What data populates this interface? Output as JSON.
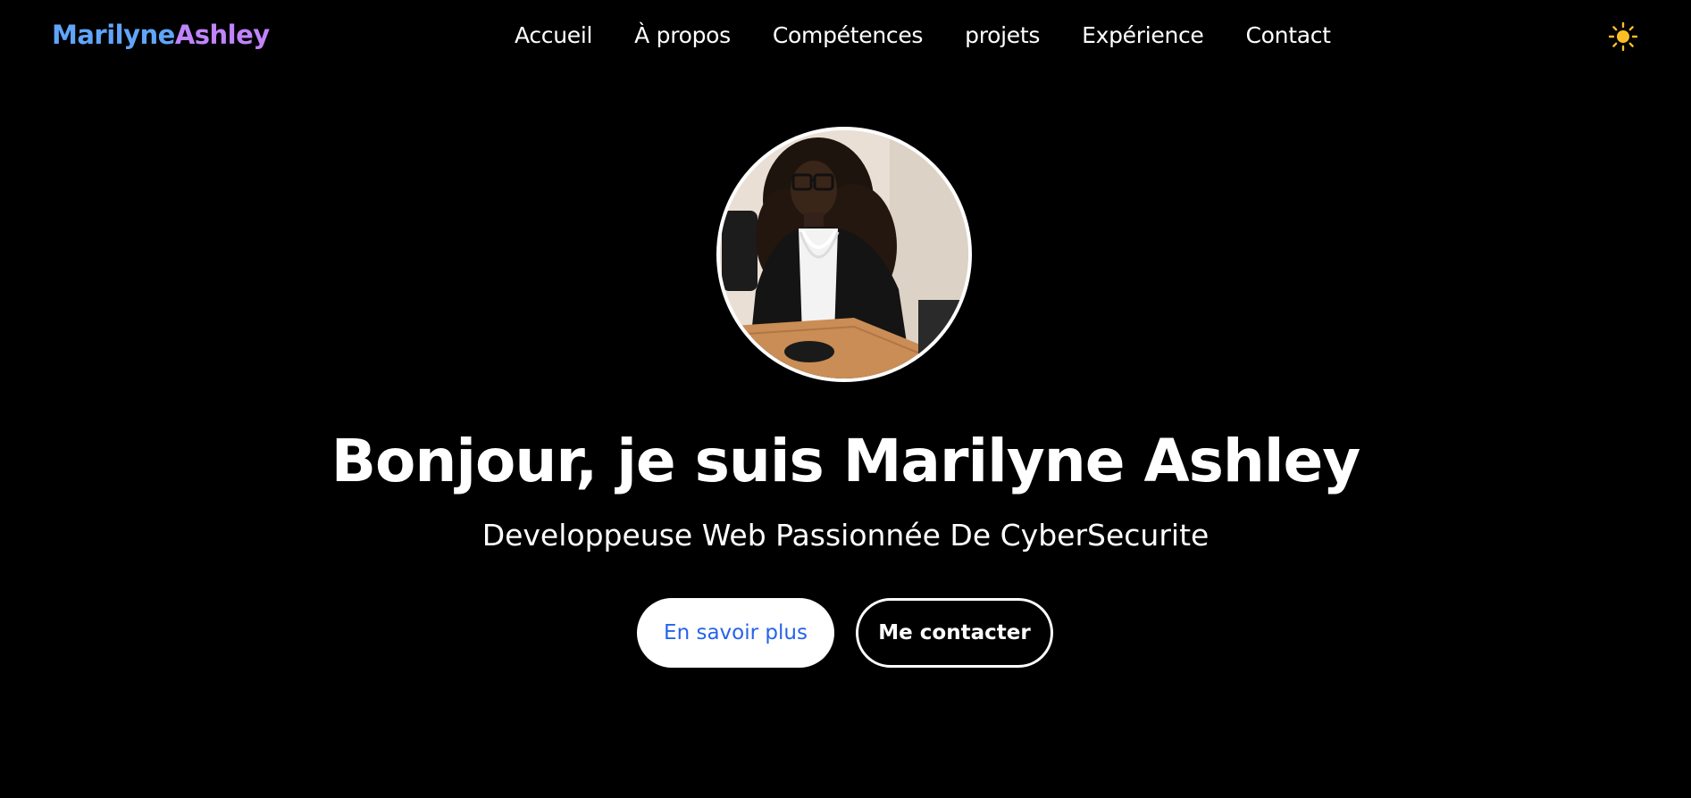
{
  "header": {
    "logo_first": "Marilyne",
    "logo_second": "Ashley",
    "nav": [
      "Accueil",
      "À propos",
      "Compétences",
      "projets",
      "Expérience",
      "Contact"
    ],
    "theme_icon": "sun-icon"
  },
  "hero": {
    "avatar_icon": "profile-photo",
    "title": "Bonjour, je suis Marilyne Ashley",
    "subtitle": "Developpeuse Web Passionnée De CyberSecurite",
    "primary_button": "En savoir plus",
    "secondary_button": "Me contacter"
  },
  "colors": {
    "background": "#000000",
    "logo_first": "#60a5fa",
    "logo_second": "#c084fc",
    "primary_button_text": "#2563eb",
    "sun": "#fbbf24"
  }
}
